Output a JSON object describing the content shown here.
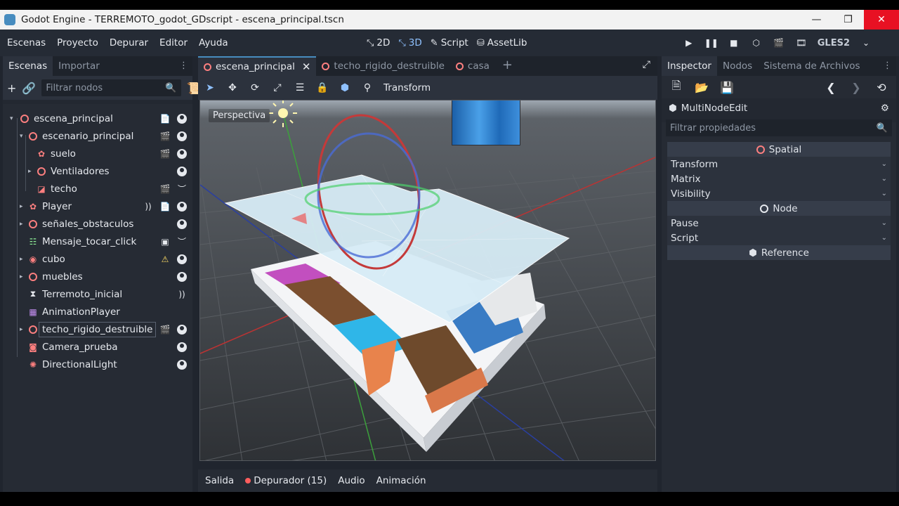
{
  "window": {
    "title": "Godot Engine - TERREMOTO_godot_GDscript - escena_principal.tscn",
    "buttons": {
      "minimize": "—",
      "maximize": "❐",
      "close": "✕"
    }
  },
  "menubar": {
    "items": [
      "Escenas",
      "Proyecto",
      "Depurar",
      "Editor",
      "Ayuda"
    ],
    "workspaces": [
      {
        "label": "2D",
        "icon": "2d-icon"
      },
      {
        "label": "3D",
        "icon": "3d-icon",
        "active": true
      },
      {
        "label": "Script",
        "icon": "script-icon"
      },
      {
        "label": "AssetLib",
        "icon": "assetlib-icon"
      }
    ],
    "renderer": "GLES2"
  },
  "scene_dock": {
    "tabs": [
      "Escenas",
      "Importar"
    ],
    "filter_placeholder": "Filtrar nodos",
    "nodes": [
      {
        "label": "escena_principal",
        "depth": 0,
        "arrow": "▾",
        "icon": "spatial-icon"
      },
      {
        "label": "escenario_principal",
        "depth": 1,
        "arrow": "▾",
        "icon": "spatial-icon"
      },
      {
        "label": "suelo",
        "depth": 2,
        "arrow": "",
        "icon": "rigidbody-icon"
      },
      {
        "label": "Ventiladores",
        "depth": 2,
        "arrow": "▸",
        "icon": "spatial-icon"
      },
      {
        "label": "techo",
        "depth": 2,
        "arrow": "",
        "icon": "staticbody-icon"
      },
      {
        "label": "Player",
        "depth": 1,
        "arrow": "▸",
        "icon": "kinematic-icon"
      },
      {
        "label": "señales_obstaculos",
        "depth": 1,
        "arrow": "▸",
        "icon": "spatial-icon"
      },
      {
        "label": "Mensaje_tocar_click",
        "depth": 1,
        "arrow": "",
        "icon": "gridcontainer-icon"
      },
      {
        "label": "cubo",
        "depth": 1,
        "arrow": "▸",
        "icon": "rigidbody-icon"
      },
      {
        "label": "muebles",
        "depth": 1,
        "arrow": "▸",
        "icon": "spatial-icon"
      },
      {
        "label": "Terremoto_inicial",
        "depth": 1,
        "arrow": "",
        "icon": "timer-icon"
      },
      {
        "label": "AnimationPlayer",
        "depth": 1,
        "arrow": "",
        "icon": "animationplayer-icon"
      },
      {
        "label": "techo_rigido_destruible",
        "depth": 1,
        "arrow": "▸",
        "icon": "spatial-icon"
      },
      {
        "label": "Camera_prueba",
        "depth": 1,
        "arrow": "",
        "icon": "camera-icon"
      },
      {
        "label": "DirectionalLight",
        "depth": 1,
        "arrow": "",
        "icon": "light-icon"
      }
    ]
  },
  "center": {
    "tabs": [
      {
        "label": "escena_principal",
        "active": true
      },
      {
        "label": "techo_rigido_destruible"
      },
      {
        "label": "casa"
      }
    ],
    "toolbar_menu": "Transform",
    "viewport_label": "Perspectiva",
    "bottom_tabs": [
      "Salida",
      "Depurador (15)",
      "Audio",
      "Animación"
    ]
  },
  "inspector": {
    "tabs": [
      "Inspector",
      "Nodos",
      "Sistema de Archivos"
    ],
    "object": "MultiNodeEdit",
    "filter_placeholder": "Filtrar propiedades",
    "sections": [
      {
        "title": "Spatial",
        "props": [
          "Transform",
          "Matrix",
          "Visibility"
        ]
      },
      {
        "title": "Node",
        "props": [
          "Pause",
          "Script"
        ]
      },
      {
        "title": "Reference",
        "props": []
      }
    ]
  }
}
